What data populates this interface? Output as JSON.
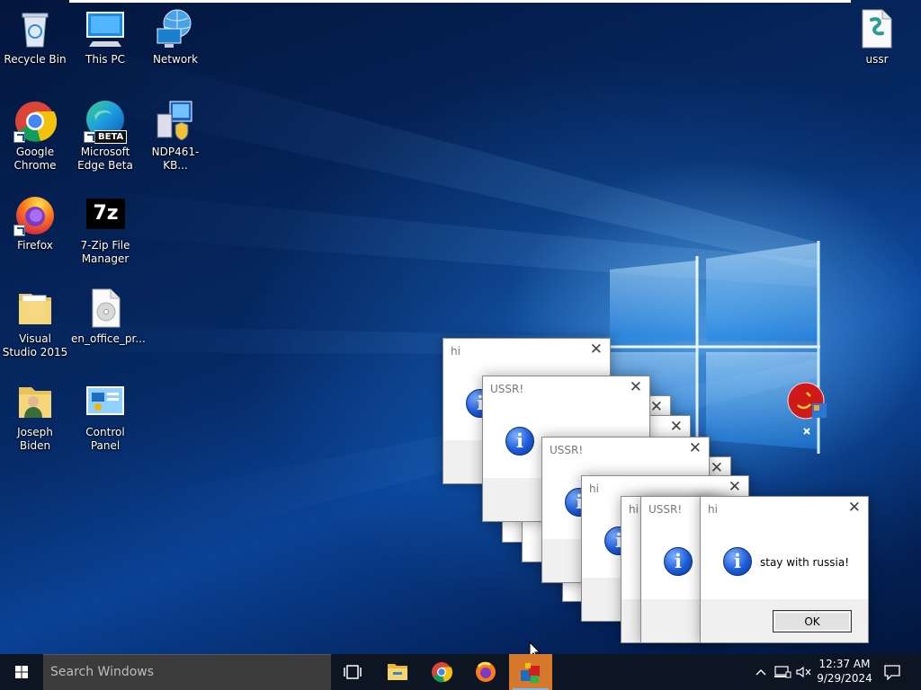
{
  "desktop_icons": [
    {
      "label": "Recycle Bin",
      "icon": "recycle-bin-icon"
    },
    {
      "label": "This PC",
      "icon": "this-pc-icon"
    },
    {
      "label": "Network",
      "icon": "network-icon"
    },
    {
      "label": "Google Chrome",
      "icon": "chrome-icon"
    },
    {
      "label": "Microsoft Edge Beta",
      "icon": "edge-beta-icon"
    },
    {
      "label": "NDP461-KB...",
      "icon": "installer-icon"
    },
    {
      "label": "Firefox",
      "icon": "firefox-icon"
    },
    {
      "label": "7-Zip File Manager",
      "icon": "7zip-icon"
    },
    {
      "label": "Visual Studio 2015",
      "icon": "folder-icon"
    },
    {
      "label": "en_office_pr...",
      "icon": "disc-image-icon"
    },
    {
      "label": "Joseph Biden",
      "icon": "user-folder-icon"
    },
    {
      "label": "Control Panel",
      "icon": "control-panel-icon"
    },
    {
      "label": "ussr",
      "icon": "script-file-icon"
    }
  ],
  "edge_beta_badge": "BETA",
  "sevenzip_badge": "7z",
  "dialogs": [
    {
      "title": "hi",
      "message": "stay with russia!",
      "ok": "OK"
    },
    {
      "title": "USSR!"
    },
    {
      "title": "USSR!"
    },
    {
      "title": "hi"
    },
    {
      "title": "hi"
    },
    {
      "title": "USSR!"
    },
    {
      "title": "hi"
    }
  ],
  "close_glyph": "✕",
  "info_glyph": "i",
  "taskbar": {
    "search_placeholder": "Search Windows",
    "time": "12:37 AM",
    "date": "9/29/2024"
  },
  "colors": {
    "taskbar": "#0d1523",
    "active_app": "#d7792a",
    "accent": "#76b9ed"
  }
}
